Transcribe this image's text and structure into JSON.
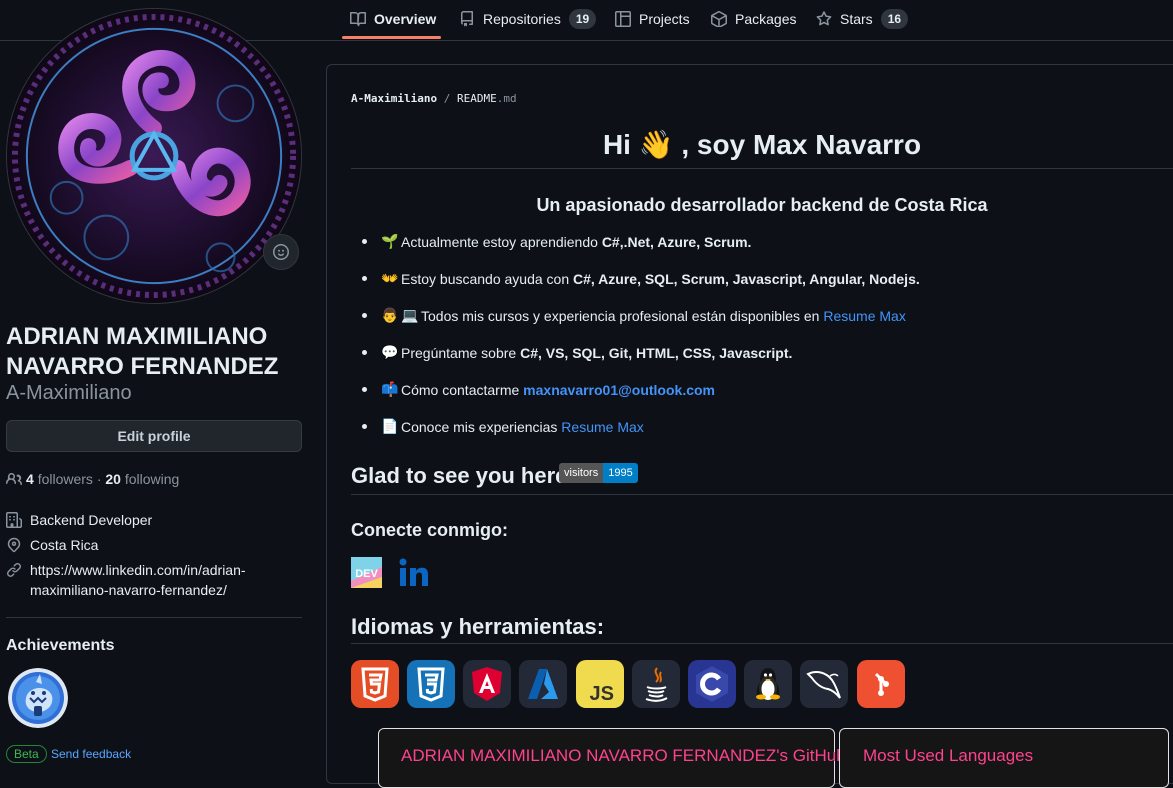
{
  "nav": {
    "tabs": [
      {
        "label": "Overview",
        "icon": "book-icon"
      },
      {
        "label": "Repositories",
        "count": "19",
        "icon": "repo-icon"
      },
      {
        "label": "Projects",
        "icon": "project-icon"
      },
      {
        "label": "Packages",
        "icon": "package-icon"
      },
      {
        "label": "Stars",
        "count": "16",
        "icon": "star-icon"
      }
    ],
    "active_tab": "Overview"
  },
  "profile": {
    "full_name": "ADRIAN MAXIMILIANO NAVARRO FERNANDEZ",
    "login": "A-Maximiliano",
    "edit_label": "Edit profile",
    "followers_count": "4",
    "followers_label": "followers",
    "following_count": "20",
    "following_label": "following",
    "company": "Backend Developer",
    "location": "Costa Rica",
    "website_line1": "https://www.linkedin.com/in/adrian-",
    "website_line2": "maximiliano-navarro-fernandez/",
    "achievements_title": "Achievements",
    "beta_label": "Beta",
    "feedback_label": "Send feedback"
  },
  "readme": {
    "breadcrumb_owner": "A-Maximiliano",
    "breadcrumb_sep": "/",
    "breadcrumb_file": "README",
    "breadcrumb_ext": ".md",
    "heading": "Hi 👋 , soy Max Navarro",
    "subheading": "Un apasionado desarrollador backend de Costa Rica",
    "items": {
      "i1_text": "Actualmente estoy aprendiendo",
      "i1_bold": "C#,.Net, Azure, Scrum.",
      "i2_text": "Estoy buscando ayuda con",
      "i2_bold": "C#, Azure, SQL, Scrum, Javascript, Angular, Nodejs.",
      "i3_text": "Todos mis cursos y experiencia profesional están disponibles en",
      "i3_link": "Resume Max",
      "i4_text": "Pregúntame sobre",
      "i4_bold": "C#, VS, SQL, Git, HTML, CSS, Javascript.",
      "i5_text": "Cómo contactarme",
      "i5_link": "maxnavarro01@outlook.com",
      "i6_text": "Conoce mis experiencias",
      "i6_link": "Resume Max"
    },
    "glad_heading": "Glad to see you here!",
    "visitors_label": "visitors",
    "visitors_count": "1995",
    "connect_heading": "Conecte conmigo:",
    "tools_heading": "Idiomas y herramientas:",
    "dev_label": "DEV",
    "js_label": "JS",
    "stats_card_title": "ADRIAN MAXIMILIANO NAVARRO FERNANDEZ's GitHub",
    "langs_card_title": "Most Used Languages"
  },
  "colors": {
    "background": "#0d1117",
    "border": "#30363d",
    "link": "#4493f8",
    "tab_underline": "#f78166",
    "card_title": "#fe428e"
  }
}
